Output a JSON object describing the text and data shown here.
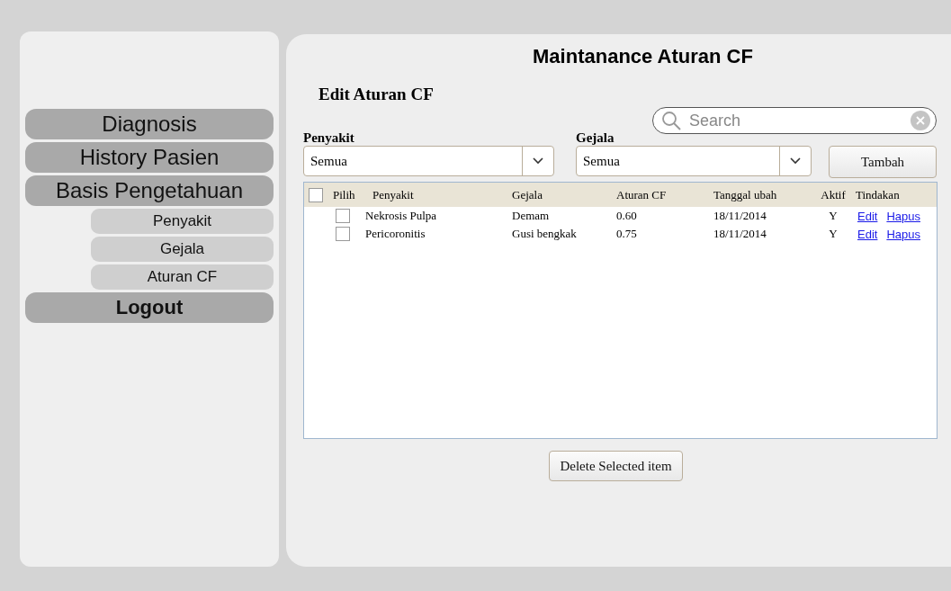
{
  "sidebar": {
    "items": [
      {
        "label": "Diagnosis",
        "kind": "main"
      },
      {
        "label": "History Pasien",
        "kind": "main"
      },
      {
        "label": "Basis Pengetahuan",
        "kind": "main"
      },
      {
        "label": "Penyakit",
        "kind": "sub"
      },
      {
        "label": "Gejala",
        "kind": "sub"
      },
      {
        "label": "Aturan CF",
        "kind": "sub"
      },
      {
        "label": "Logout",
        "kind": "strong"
      }
    ]
  },
  "main": {
    "title": "Maintanance Aturan CF",
    "subtitle": "Edit Aturan CF",
    "search": {
      "placeholder": "Search"
    },
    "filters": [
      {
        "label": "Penyakit",
        "value": "Semua"
      },
      {
        "label": "Gejala",
        "value": "Semua"
      }
    ],
    "add_button": "Tambah",
    "table": {
      "select_all_checked": false,
      "columns": [
        "Pilih",
        "Penyakit",
        "Gejala",
        "Aturan CF",
        "Tanggal ubah",
        "Aktif",
        "Tindakan"
      ],
      "rows": [
        {
          "checked": false,
          "penyakit": "Nekrosis Pulpa",
          "gejala": "Demam",
          "cf": "0.60",
          "tanggal": "18/11/2014",
          "aktif": "Y",
          "actions": [
            "Edit",
            "Hapus"
          ]
        },
        {
          "checked": false,
          "penyakit": "Pericoronitis",
          "gejala": "Gusi bengkak",
          "cf": "0.75",
          "tanggal": "18/11/2014",
          "aktif": "Y",
          "actions": [
            "Edit",
            "Hapus"
          ]
        }
      ]
    },
    "delete_button": "Delete Selected item"
  }
}
